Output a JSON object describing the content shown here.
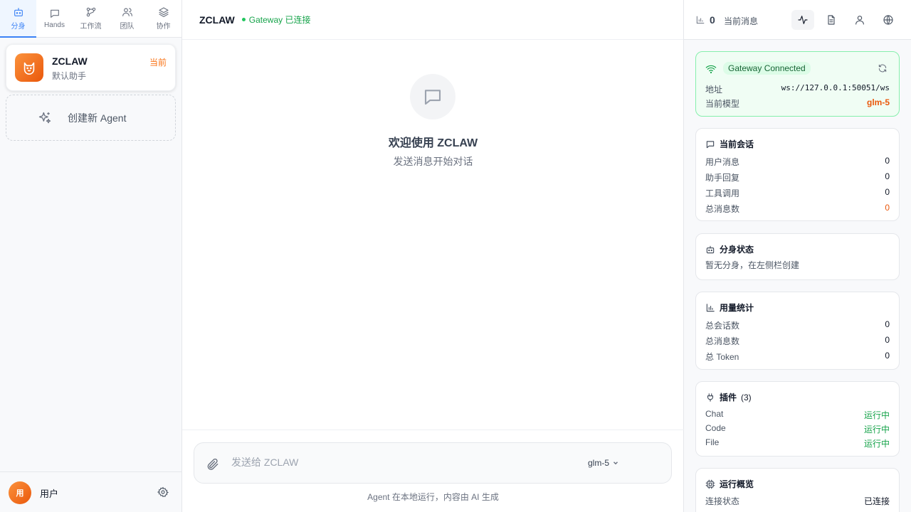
{
  "sidebar": {
    "tabs": [
      {
        "label": "分身",
        "icon": "bot-icon",
        "active": true
      },
      {
        "label": "Hands",
        "icon": "message-icon",
        "active": false
      },
      {
        "label": "工作流",
        "icon": "workflow-icon",
        "active": false
      },
      {
        "label": "团队",
        "icon": "users-icon",
        "active": false
      },
      {
        "label": "协作",
        "icon": "layers-icon",
        "active": false
      }
    ],
    "agent": {
      "name": "ZCLAW",
      "desc": "默认助手",
      "badge": "当前",
      "icon": "cat-icon"
    },
    "create_label": "创建新 Agent",
    "user": {
      "avatar": "用",
      "name": "用户"
    }
  },
  "main": {
    "title": "ZCLAW",
    "status": "Gateway 已连接",
    "welcome_title": "欢迎使用 ZCLAW",
    "welcome_sub": "发送消息开始对话",
    "input_placeholder": "发送给 ZCLAW",
    "model": "glm-5",
    "footer_note": "Agent 在本地运行，内容由 AI 生成"
  },
  "right": {
    "header": {
      "count": "0",
      "label": "当前消息"
    },
    "gateway": {
      "badge": "Gateway Connected",
      "address_label": "地址",
      "address": "ws://127.0.0.1:50051/ws",
      "model_label": "当前模型",
      "model": "glm-5"
    },
    "session": {
      "title": "当前会话",
      "rows": [
        {
          "label": "用户消息",
          "value": "0"
        },
        {
          "label": "助手回复",
          "value": "0"
        },
        {
          "label": "工具调用",
          "value": "0"
        },
        {
          "label": "总消息数",
          "value": "0"
        }
      ]
    },
    "clones": {
      "title": "分身状态",
      "empty": "暂无分身，在左侧栏创建"
    },
    "usage": {
      "title": "用量统计",
      "rows": [
        {
          "label": "总会话数",
          "value": "0"
        },
        {
          "label": "总消息数",
          "value": "0"
        },
        {
          "label": "总 Token",
          "value": "0"
        }
      ]
    },
    "plugins": {
      "title": "插件",
      "count": "(3)",
      "rows": [
        {
          "label": "Chat",
          "value": "运行中"
        },
        {
          "label": "Code",
          "value": "运行中"
        },
        {
          "label": "File",
          "value": "运行中"
        }
      ]
    },
    "overview": {
      "title": "运行概览",
      "rows": [
        {
          "label": "连接状态",
          "value": "已连接"
        }
      ]
    }
  },
  "colors": {
    "accent": "#3b82f6",
    "brand_orange": "#f97316",
    "success": "#16a34a"
  }
}
